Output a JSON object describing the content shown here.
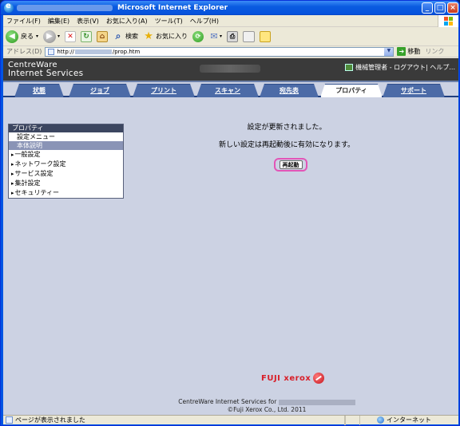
{
  "window": {
    "title": "Microsoft Internet Explorer"
  },
  "menubar": {
    "items": [
      "ファイル(F)",
      "編集(E)",
      "表示(V)",
      "お気に入り(A)",
      "ツール(T)",
      "ヘルプ(H)"
    ]
  },
  "toolbar": {
    "back_label": "戻る",
    "search_label": "検索",
    "favorites_label": "お気に入り"
  },
  "addressbar": {
    "label": "アドレス(D)",
    "url_prefix": "http://",
    "url_suffix": "/prop.htm",
    "go_label": "移動",
    "links_label": "リンク"
  },
  "header": {
    "logo_line1": "CentreWare",
    "logo_line2": "Internet Services",
    "user_text": "機械管理者 - ログアウト| ヘルプ..."
  },
  "tabs": [
    "状態",
    "ジョブ",
    "プリント",
    "スキャン",
    "宛先表",
    "プロパティ",
    "サポート"
  ],
  "active_tab": "プロパティ",
  "sidebar": {
    "header": "プロパティ",
    "rows": [
      "設定メニュー",
      "本体説明"
    ],
    "selected": "本体説明",
    "expandable": [
      "一般設定",
      "ネットワーク設定",
      "サービス設定",
      "集計設定",
      "セキュリティー"
    ]
  },
  "main": {
    "message1": "設定が更新されました。",
    "message2": "新しい設定は再起動後に有効になります。",
    "reboot_label": "再起動"
  },
  "footer": {
    "brand": "FUJI xerox",
    "line1_prefix": "CentreWare Internet Services for",
    "line2": "©Fuji Xerox Co., Ltd. 2011"
  },
  "statusbar": {
    "text": "ページが表示されました",
    "zone": "インターネット"
  }
}
